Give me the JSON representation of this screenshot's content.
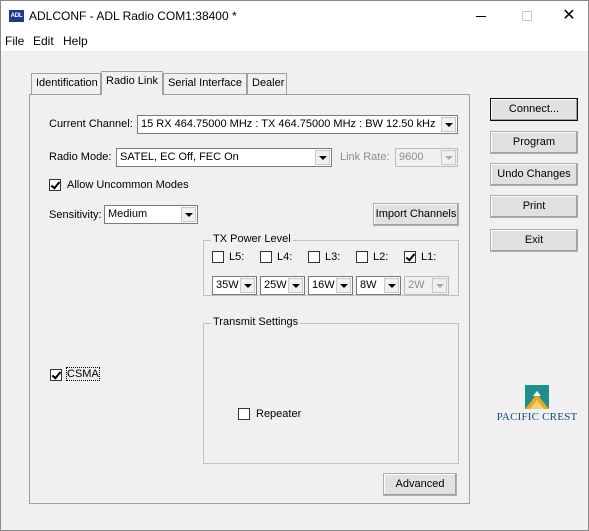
{
  "window": {
    "icon_text": "ADL",
    "title": "ADLCONF - ADL Radio COM1:38400 *",
    "controls": [
      "minimize-icon",
      "maximize-icon",
      "close-icon"
    ],
    "close_glyph": "✕"
  },
  "menu": [
    "File",
    "Edit",
    "Help"
  ],
  "tabs": [
    "Identification",
    "Radio Link",
    "Serial Interface",
    "Dealer"
  ],
  "active_tab": "Radio Link",
  "radio_link": {
    "current_channel_label": "Current Channel:",
    "current_channel_value": "15  RX 464.75000 MHz : TX 464.75000 MHz : BW 12.50 kHz",
    "radio_mode_label": "Radio Mode:",
    "radio_mode_value": "SATEL, EC Off, FEC On",
    "link_rate_label": "Link Rate:",
    "link_rate_value": "9600",
    "allow_uncommon_label": "Allow Uncommon Modes",
    "allow_uncommon_checked": true,
    "sensitivity_label": "Sensitivity:",
    "sensitivity_value": "Medium",
    "import_channels_label": "Import Channels",
    "tx_power": {
      "title": "TX Power Level",
      "levels": [
        {
          "label": "L5:",
          "checked": false,
          "value": "35W"
        },
        {
          "label": "L4:",
          "checked": false,
          "value": "25W"
        },
        {
          "label": "L3:",
          "checked": false,
          "value": "16W"
        },
        {
          "label": "L2:",
          "checked": false,
          "value": "8W"
        },
        {
          "label": "L1:",
          "checked": true,
          "value": "2W"
        }
      ]
    },
    "transmit_settings_title": "Transmit Settings",
    "csma_label": "CSMA",
    "csma_checked": true,
    "repeater_label": "Repeater",
    "repeater_checked": false,
    "advanced_label": "Advanced"
  },
  "side_buttons": {
    "connect": "Connect...",
    "program": "Program",
    "undo": "Undo Changes",
    "print": "Print",
    "exit": "Exit"
  },
  "logo": {
    "text": "PACIFIC CREST",
    "colors": {
      "teal": "#1f8e8c",
      "gold": "#e3a92b",
      "navy": "#1c4a7a"
    }
  }
}
